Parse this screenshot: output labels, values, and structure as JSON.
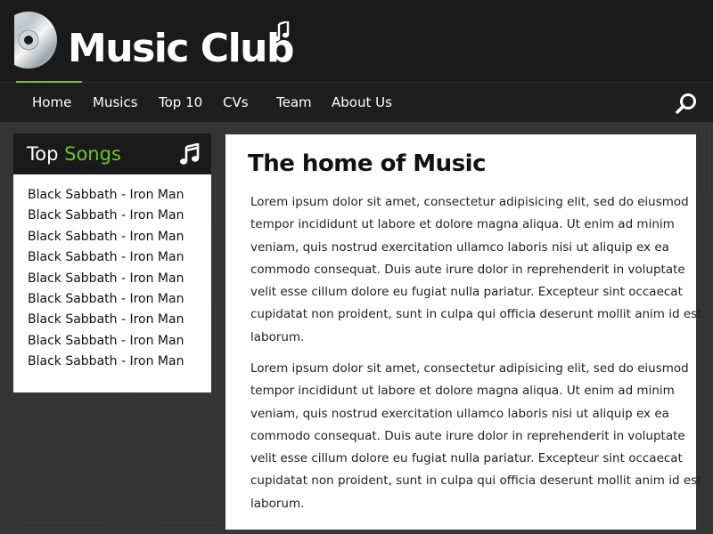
{
  "site": {
    "title": "Music Club",
    "accent_color": "#6ec32b",
    "logo_icon": "cd-disc-icon",
    "logo_note_icon": "music-note-icon"
  },
  "nav": {
    "items": [
      {
        "label": "Home"
      },
      {
        "label": "Musics"
      },
      {
        "label": "Top 10"
      },
      {
        "label": "CVs"
      },
      {
        "label": "Team"
      },
      {
        "label": "About Us"
      }
    ],
    "active_item": "Home",
    "search_icon": "search-icon"
  },
  "sidebar": {
    "title_plain": "Top",
    "title_accent": "Songs",
    "icon": "music-note-icon",
    "songs": [
      "Black Sabbath - Iron Man",
      "Black Sabbath - Iron Man",
      "Black Sabbath - Iron Man",
      "Black Sabbath - Iron Man",
      "Black Sabbath - Iron Man",
      "Black Sabbath - Iron Man",
      "Black Sabbath - Iron Man",
      "Black Sabbath - Iron Man",
      "Black Sabbath - Iron Man"
    ]
  },
  "main": {
    "title": "The home of Music",
    "paragraphs": [
      {
        "lines": [
          "Lorem ipsum dolor sit amet, consectetur adipisicing elit, sed do eiusmod",
          " tempor incididunt ut labore et dolore magna aliqua. Ut enim ad minim",
          " veniam, quis nostrud exercitation ullamco laboris nisi ut aliquip ex ea",
          "commodo consequat. Duis aute irure dolor in reprehenderit in voluptate",
          "velit esse cillum dolore eu fugiat nulla pariatur. Excepteur sint occaecat",
          "cupidatat non proident, sunt in culpa qui officia deserunt mollit anim id est",
          " laborum."
        ]
      },
      {
        "lines": [
          "Lorem ipsum dolor sit amet, consectetur adipisicing elit, sed do eiusmod",
          " tempor incididunt ut labore et dolore magna aliqua. Ut enim ad minim",
          " veniam, quis nostrud exercitation ullamco laboris nisi ut aliquip ex ea",
          "commodo consequat. Duis aute irure dolor in reprehenderit in voluptate",
          "velit esse cillum dolore eu fugiat nulla pariatur. Excepteur sint occaecat",
          "cupidatat non proident, sunt in culpa qui officia deserunt mollit anim id est",
          " laborum."
        ]
      }
    ]
  }
}
